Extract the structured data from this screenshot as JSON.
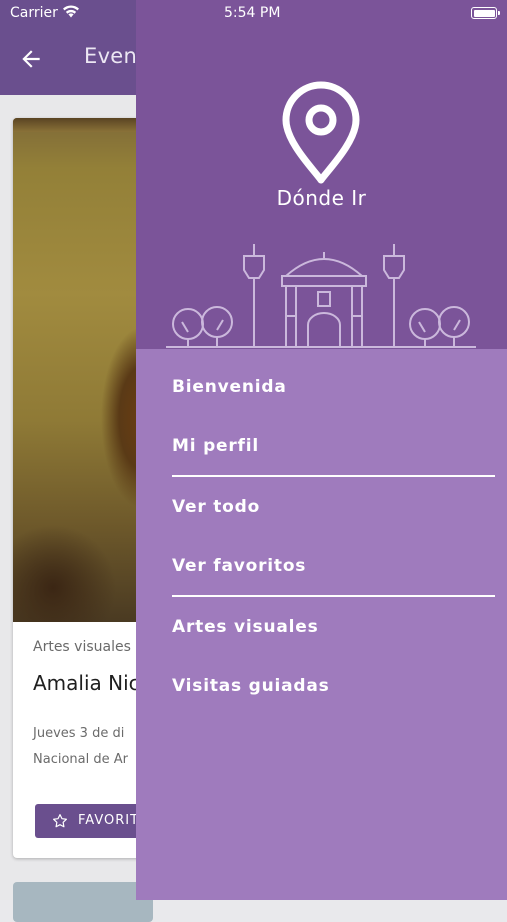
{
  "status_bar": {
    "carrier": "Carrier",
    "time": "5:54 PM"
  },
  "background_app": {
    "title": "Even",
    "card": {
      "category": "Artes visuales",
      "title": "Amalia Nic",
      "date_line1": "Jueves 3 de di",
      "date_line2": "Nacional de Ar",
      "favorite_label": "FAVORIT"
    }
  },
  "drawer": {
    "app_name": "Dónde Ir",
    "items": [
      {
        "label": "Bienvenida"
      },
      {
        "label": "Mi perfil"
      },
      {
        "label": "Ver todo"
      },
      {
        "label": "Ver favoritos"
      },
      {
        "label": "Artes visuales"
      },
      {
        "label": "Visitas guiadas"
      }
    ]
  },
  "colors": {
    "drawer_header": "#7b5499",
    "drawer_menu": "#9f7bbd",
    "app_bar": "#6a4f8e"
  }
}
